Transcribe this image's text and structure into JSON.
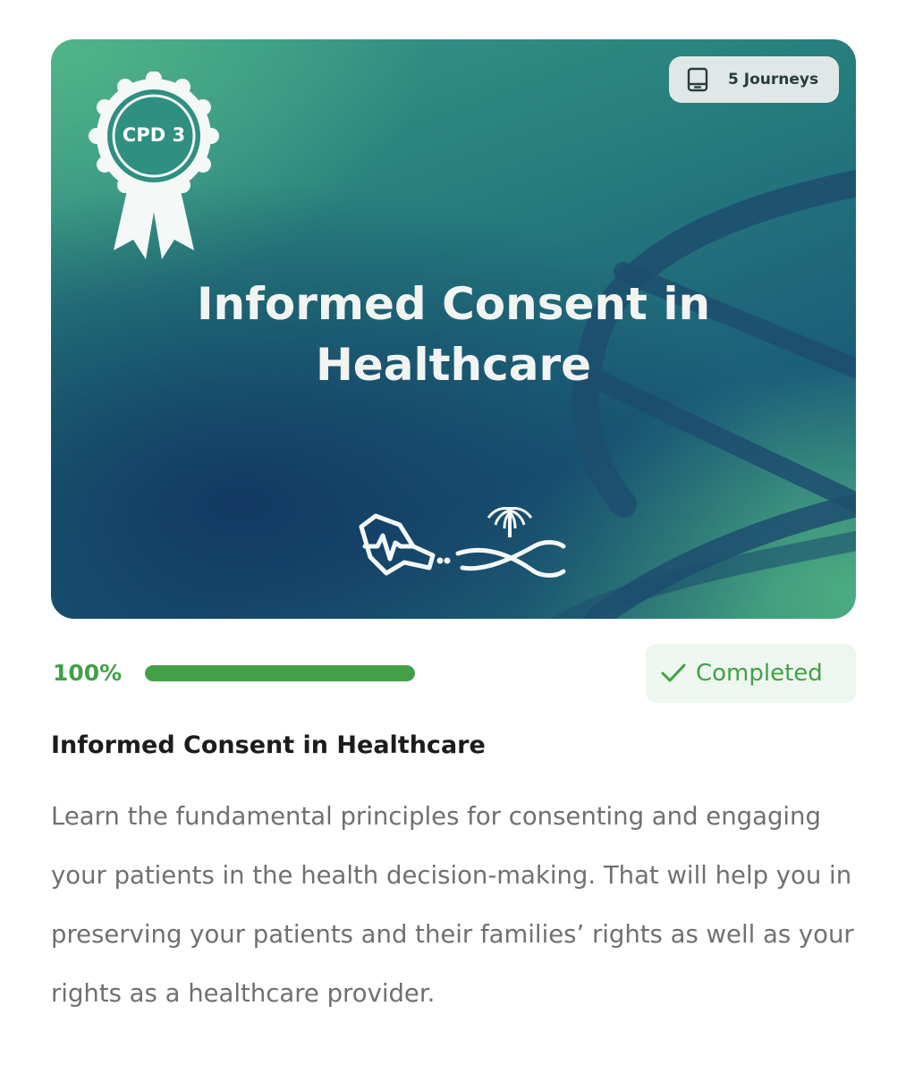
{
  "banner": {
    "journeys_label": "5 Journeys",
    "journeys_icon": "tablet-icon",
    "cpd_label": "CPD 3",
    "cpd_icon": "award-ribbon-icon",
    "title": "Informed Consent in Healthcare",
    "logos": [
      "health-map-logo",
      "palm-swords-emblem"
    ],
    "colors": {
      "teal": "#247a7c",
      "navy": "#1b3f66",
      "green": "#52b688"
    }
  },
  "progress": {
    "percent_label": "100%",
    "percent": 100,
    "status_label": "Completed",
    "status_icon": "checkmark-icon",
    "accent": "#43a047"
  },
  "course": {
    "title": "Informed Consent in Healthcare",
    "description": "Learn the fundamental principles for consenting and engaging your patients in the health decision-making. That will help you in preserving your patients and their families’ rights as well as your rights as a healthcare provider."
  }
}
